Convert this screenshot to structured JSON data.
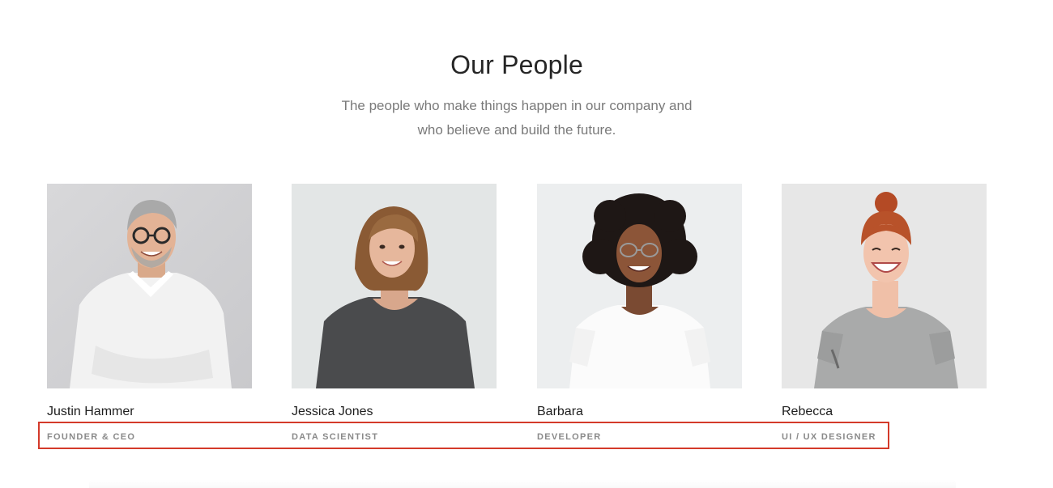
{
  "section": {
    "title": "Our People",
    "subtitle_line1": "The people who make things happen in our company and",
    "subtitle_line2": "who believe and build the future."
  },
  "team": [
    {
      "name": "Justin Hammer",
      "role": "FOUNDER & CEO",
      "photo": "man-glasses-white-shirt-photo"
    },
    {
      "name": "Jessica Jones",
      "role": "DATA SCIENTIST",
      "photo": "woman-dark-tshirt-photo"
    },
    {
      "name": "Barbara",
      "role": "DEVELOPER",
      "photo": "woman-curly-hair-glasses-photo"
    },
    {
      "name": "Rebecca",
      "role": "UI / UX DESIGNER",
      "photo": "woman-red-bun-grey-tshirt-photo"
    }
  ],
  "colors": {
    "highlight": "#d43a2a",
    "title": "#262626",
    "subtitle": "#7a7a7a",
    "role": "#8a8a8a"
  }
}
